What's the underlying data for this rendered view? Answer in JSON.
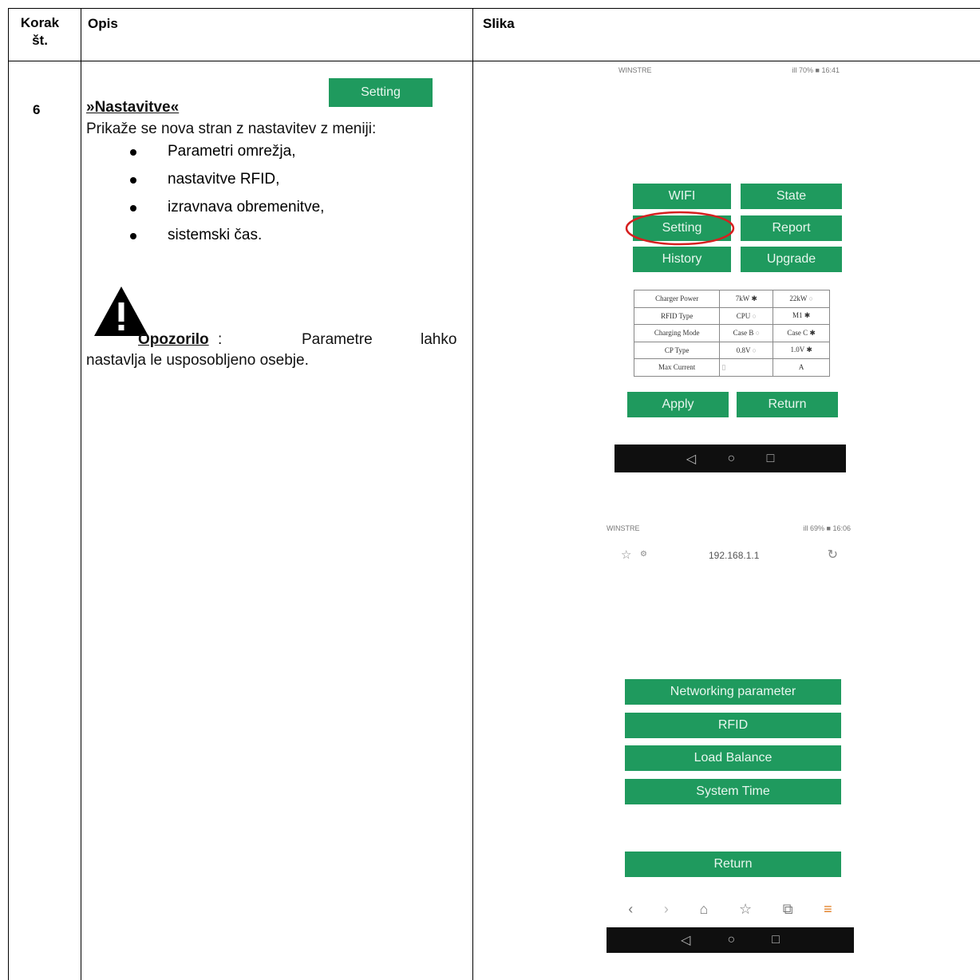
{
  "headers": {
    "step": "Korak št.",
    "description": "Opis",
    "image": "Slika"
  },
  "row": {
    "step_number": "6",
    "heading": "»Nastavitve«",
    "intro": "Prikaže se nova stran z nastavitev z meniji:",
    "bullets": [
      "Parametri omrežja,",
      "nastavitve RFID,",
      "izravnava obremenitve,",
      "sistemski čas."
    ],
    "warning_label": "Opozorilo",
    "warning_colon": ":",
    "warning_text_1": "Parametre",
    "warning_text_2": "lahko",
    "warning_text_3": "nastavlja le usposobljeno osebje.",
    "setting_button_label": "Setting"
  },
  "phone1": {
    "carrier": "WINSTRE",
    "status_right": "ill 70% ■ 16:41",
    "buttons": [
      "WIFI",
      "State",
      "Setting",
      "Report",
      "History",
      "Upgrade"
    ],
    "table": [
      [
        "Charger Power",
        "7kW",
        "22kW"
      ],
      [
        "RFID Type",
        "CPU",
        "M1"
      ],
      [
        "Charging Mode",
        "Case B",
        "Case C"
      ],
      [
        "CP Type",
        "0.8V",
        "1.0V"
      ]
    ],
    "max_current_label": "Max Current",
    "max_current_unit": "A",
    "apply_label": "Apply",
    "return_label": "Return",
    "nav_back": "◁",
    "nav_home": "○",
    "nav_recent": "□"
  },
  "phone2": {
    "carrier": "WINSTRE",
    "status_right": "ill 69% ■ 16:06",
    "url": "192.168.1.1",
    "menu": [
      "Networking parameter",
      "RFID",
      "Load Balance",
      "System Time"
    ],
    "return_label": "Return",
    "nav_back": "◁",
    "nav_home": "○",
    "nav_recent": "□"
  }
}
